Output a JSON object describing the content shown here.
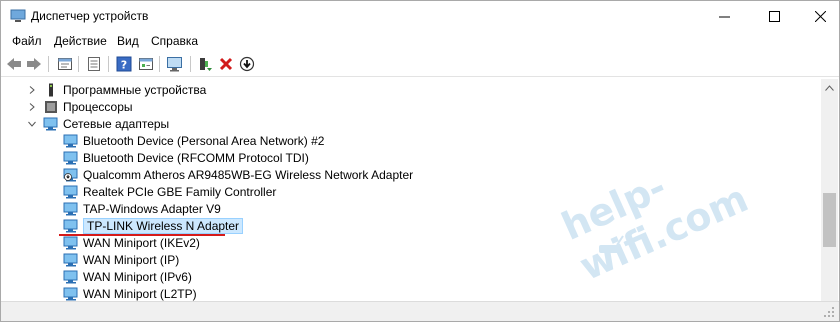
{
  "window": {
    "title": "Диспетчер устройств",
    "accent_color": "#2b8ed8"
  },
  "titlebar_buttons": {
    "minimize": "minimize-icon",
    "maximize": "maximize-icon",
    "close": "close-icon"
  },
  "menu": {
    "file": "Файл",
    "action": "Действие",
    "view": "Вид",
    "help": "Справка"
  },
  "toolbar": {
    "icons": [
      "back-icon",
      "forward-icon",
      "properties-icon",
      "list-icon",
      "help-icon",
      "view-icon",
      "monitor-scan-icon",
      "update-driver-icon",
      "uninstall-icon",
      "download-icon"
    ]
  },
  "tree": {
    "software_devices": "Программные устройства",
    "processors": "Процессоры",
    "network_adapters": "Сетевые адаптеры",
    "adapters": [
      "Bluetooth Device (Personal Area Network) #2",
      "Bluetooth Device (RFCOMM Protocol TDI)",
      "Qualcomm Atheros AR9485WB-EG Wireless Network Adapter",
      "Realtek PCIe GBE Family Controller",
      "TAP-Windows Adapter V9",
      "TP-LINK Wireless N Adapter",
      "WAN Miniport (IKEv2)",
      "WAN Miniport (IP)",
      "WAN Miniport (IPv6)",
      "WAN Miniport (L2TP)"
    ],
    "selected_index": 5,
    "highlight_color": "#d51a1a"
  },
  "watermark": {
    "text": "help-wifi.com"
  }
}
